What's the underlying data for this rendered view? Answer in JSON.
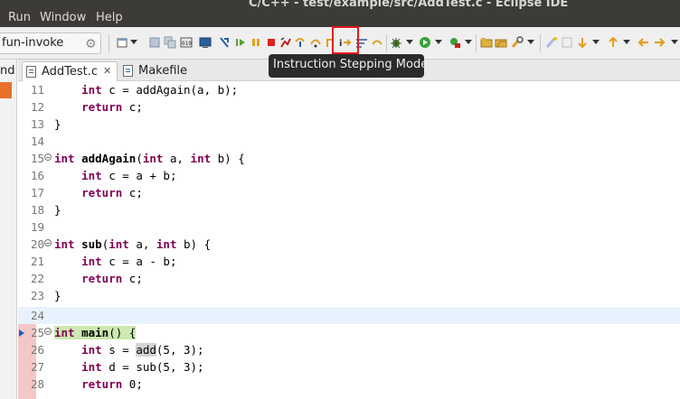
{
  "window": {
    "title": "C/C++ - test/example/src/AddTest.c - Eclipse IDE"
  },
  "menu": {
    "items": [
      {
        "label": "Run"
      },
      {
        "label": "Window"
      },
      {
        "label": "Help"
      }
    ]
  },
  "toolbar": {
    "launch_config": "fun-invoke",
    "tooltip": "Instruction Stepping Mode"
  },
  "left_view": {
    "partial_text": "nd"
  },
  "tabs": [
    {
      "label": "AddTest.c",
      "active": true
    },
    {
      "label": "Makefile",
      "active": false
    }
  ],
  "editor": {
    "lines": [
      {
        "num": "11",
        "pre": "    ",
        "kw": "int",
        "rest": " c = addAgain(a, b);"
      },
      {
        "num": "12",
        "pre": "    ",
        "kw": "return",
        "rest": " c;"
      },
      {
        "num": "13",
        "text": "}"
      },
      {
        "num": "14",
        "text": ""
      },
      {
        "num": "15",
        "fold": true,
        "kw": "int",
        "fn": "addAgain",
        "p1kw": "int",
        "p1": " a, ",
        "p2kw": "int",
        "p2": " b) {"
      },
      {
        "num": "16",
        "pre": "    ",
        "kw": "int",
        "rest": " c = a + b;"
      },
      {
        "num": "17",
        "pre": "    ",
        "kw": "return",
        "rest": " c;"
      },
      {
        "num": "18",
        "text": "}"
      },
      {
        "num": "19",
        "text": ""
      },
      {
        "num": "20",
        "fold": true,
        "kw": "int",
        "fn": "sub",
        "p1kw": "int",
        "p1": " a, ",
        "p2kw": "int",
        "p2": " b) {"
      },
      {
        "num": "21",
        "pre": "    ",
        "kw": "int",
        "rest": " c = a - b;"
      },
      {
        "num": "22",
        "pre": "    ",
        "kw": "return",
        "rest": " c;"
      },
      {
        "num": "23",
        "text": "}"
      },
      {
        "num": "24",
        "text": ""
      },
      {
        "num": "25",
        "fold": true,
        "kw": "int",
        "fn": "main",
        "rest": "() {"
      },
      {
        "num": "26",
        "pre": "    ",
        "kw": "int",
        "rest_a": " s = ",
        "hl": "add",
        "rest_b": "(5, 3);"
      },
      {
        "num": "27",
        "pre": "    ",
        "kw": "int",
        "rest": " d = sub(5, 3);"
      },
      {
        "num": "28",
        "pre": "    ",
        "kw": "return",
        "rest": " 0;"
      }
    ]
  }
}
